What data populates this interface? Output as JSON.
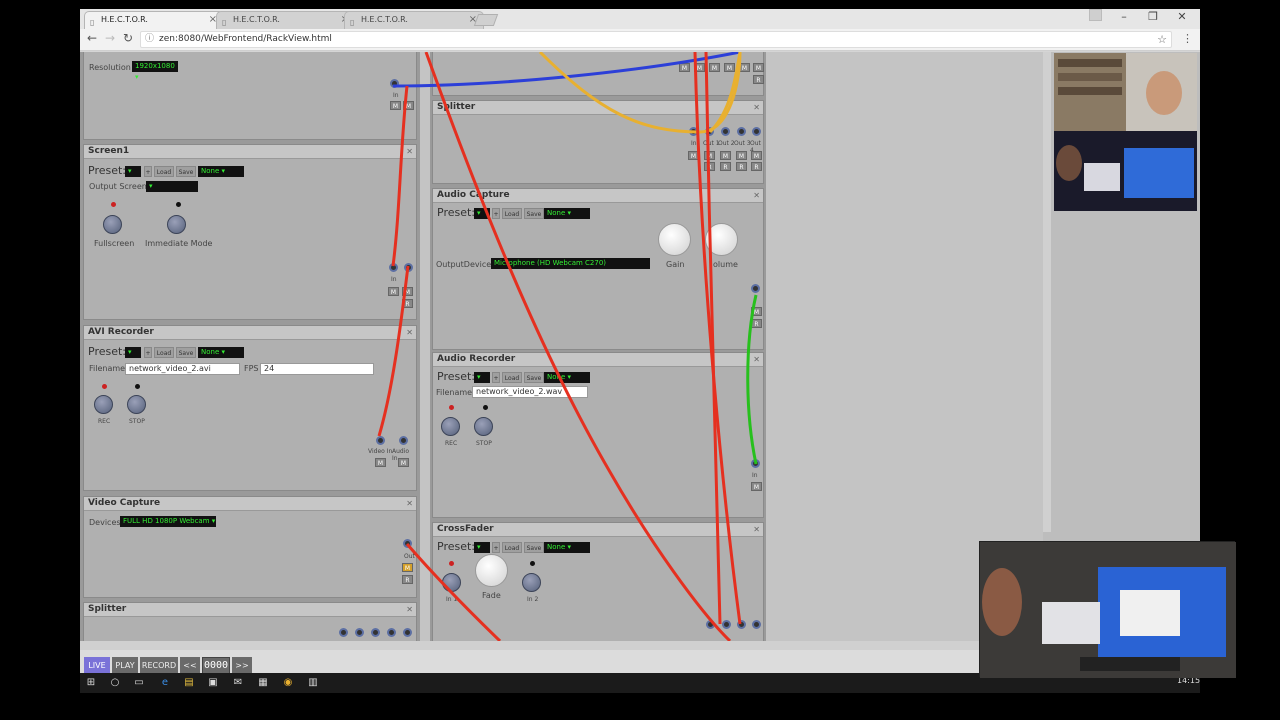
{
  "browser": {
    "tabs": [
      {
        "label": "H.E.C.T.O.R.",
        "active": true
      },
      {
        "label": "H.E.C.T.O.R.",
        "active": false
      },
      {
        "label": "H.E.C.T.O.R.",
        "active": false
      }
    ],
    "url": "zen:8080/WebFrontend/RackView.html",
    "info_icon": "info-icon",
    "star_icon": "star-icon",
    "menu_icon": "kebab-menu-icon"
  },
  "rack": {
    "display": {
      "resolution_label": "Resolution",
      "resolution_value": "1920x1080",
      "port_in": "In",
      "port_out": "Out",
      "mute": "M",
      "record": "R"
    },
    "screen1": {
      "title": "Screen1",
      "preset_label": "Preset:",
      "load": "Load",
      "save": "Save",
      "preset_value": "None",
      "output_screen_label": "Output Screen",
      "fullscreen": "Fullscreen",
      "immediate": "Immediate Mode",
      "port_in": "In",
      "port_out": "Out",
      "mute": "M",
      "record": "R"
    },
    "avi_recorder": {
      "title": "AVI Recorder",
      "preset_label": "Preset:",
      "load": "Load",
      "save": "Save",
      "preset_value": "None",
      "filename_label": "Filename",
      "filename": "network_video_2.avi",
      "fps_label": "FPS",
      "fps": "24",
      "rec": "REC",
      "stop": "STOP",
      "video_in": "Video In",
      "audio_in": "Audio In",
      "mute": "M"
    },
    "video_capture": {
      "title": "Video Capture",
      "devices_label": "Devices",
      "device_value": "FULL HD 1080P Webcam",
      "port_out": "Out",
      "mute": "M",
      "record": "R"
    },
    "splitter_left": {
      "title": "Splitter"
    },
    "splitter_right": {
      "title": "Splitter",
      "port_in": "In",
      "outs": [
        "Out 1",
        "Out 2",
        "Out 3",
        "Out 4"
      ],
      "mute": "M",
      "record": "R"
    },
    "audio_capture": {
      "title": "Audio Capture",
      "preset_label": "Preset:",
      "load": "Load",
      "save": "Save",
      "preset_value": "None",
      "output_device_label": "OutputDevice",
      "output_device": "Microphone (HD Webcam C270)",
      "gain": "Gain",
      "volume": "olume",
      "mute": "M",
      "record": "R"
    },
    "audio_recorder": {
      "title": "Audio Recorder",
      "preset_label": "Preset:",
      "load": "Load",
      "save": "Save",
      "preset_value": "None",
      "filename_label": "Filename",
      "filename": "network_video_2.wav",
      "rec": "REC",
      "stop": "STOP",
      "port_in": "In",
      "mute": "M"
    },
    "crossfader": {
      "title": "CrossFader",
      "preset_label": "Preset:",
      "load": "Load",
      "save": "Save",
      "preset_value": "None",
      "fade": "Fade",
      "in1": "In 1",
      "in2": "In 2"
    },
    "top_right": {
      "port_in": "In",
      "out": "Out",
      "mute": "M",
      "record": "R"
    }
  },
  "transport": {
    "live": "LIVE",
    "play": "PLAY",
    "record": "RECORD",
    "rewind": "<<",
    "timecode": "0000",
    "forward": ">>"
  },
  "taskbar": {
    "clock": "14:15"
  },
  "colors": {
    "cable_red": "#e53020",
    "cable_blue": "#2c3fd8",
    "cable_yellow": "#e8b030",
    "cable_green": "#27c01d",
    "select_text": "#33ee33"
  }
}
